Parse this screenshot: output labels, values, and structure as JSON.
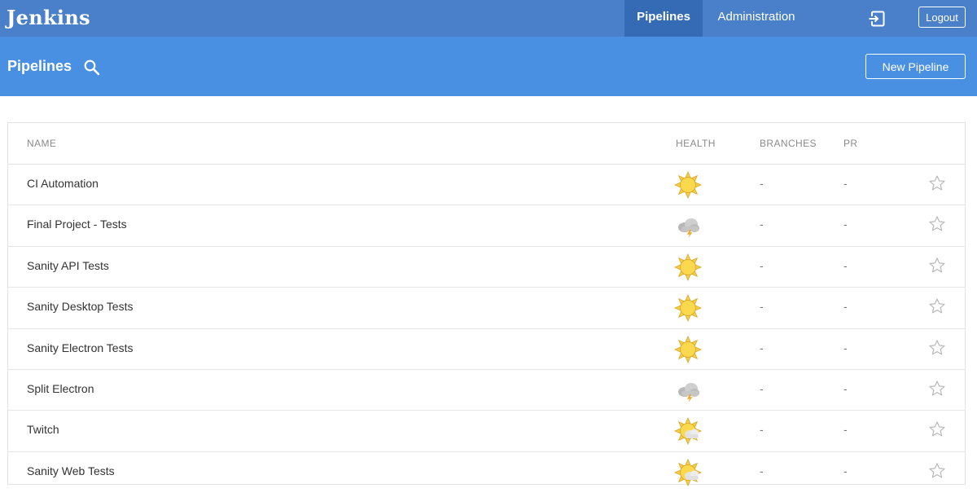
{
  "app": {
    "brand": "Jenkins"
  },
  "topnav": {
    "pipelines_label": "Pipelines",
    "admin_label": "Administration",
    "logout_label": "Logout"
  },
  "header": {
    "title": "Pipelines",
    "new_pipeline_label": "New Pipeline"
  },
  "table": {
    "columns": {
      "name": "NAME",
      "health": "HEALTH",
      "branches": "BRANCHES",
      "pr": "PR"
    },
    "rows": [
      {
        "name": "CI Automation",
        "health": "sunny",
        "branches": "-",
        "pr": "-"
      },
      {
        "name": "Final Project - Tests",
        "health": "stormy",
        "branches": "-",
        "pr": "-"
      },
      {
        "name": "Sanity API Tests",
        "health": "sunny",
        "branches": "-",
        "pr": "-"
      },
      {
        "name": "Sanity Desktop Tests",
        "health": "sunny",
        "branches": "-",
        "pr": "-"
      },
      {
        "name": "Sanity Electron Tests",
        "health": "sunny",
        "branches": "-",
        "pr": "-"
      },
      {
        "name": "Split Electron",
        "health": "stormy",
        "branches": "-",
        "pr": "-"
      },
      {
        "name": "Twitch",
        "health": "partly-cloudy",
        "branches": "-",
        "pr": "-"
      },
      {
        "name": "Sanity Web Tests",
        "health": "partly-cloudy",
        "branches": "-",
        "pr": "-"
      }
    ]
  },
  "colors": {
    "topbar": "#4a7fc9",
    "topbar_active": "#356bb5",
    "header": "#4a90e2",
    "sun": "#f7cf47",
    "cloud": "#c4c4c4"
  }
}
